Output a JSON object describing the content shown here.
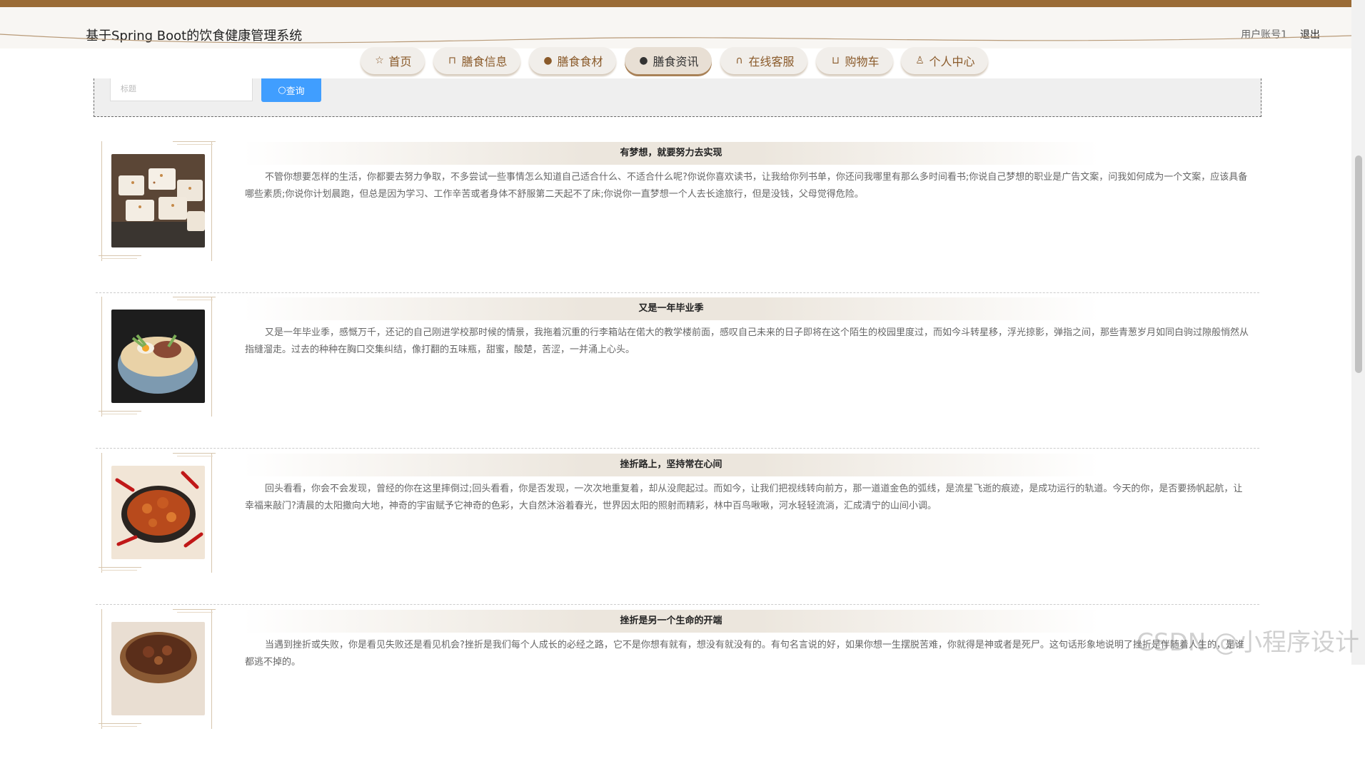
{
  "header": {
    "title": "基于Spring Boot的饮食健康管理系统",
    "user_label": "用户账号1",
    "logout_label": "退出"
  },
  "nav": [
    {
      "label": "首页",
      "icon": "star-icon",
      "glyph": "☆"
    },
    {
      "label": "膳食信息",
      "icon": "bag-icon",
      "glyph": "⊓"
    },
    {
      "label": "膳食食材",
      "icon": "info-circle-icon",
      "glyph": "●"
    },
    {
      "label": "膳食资讯",
      "icon": "help-circle-icon",
      "glyph": "●",
      "active": true
    },
    {
      "label": "在线客服",
      "icon": "headset-icon",
      "glyph": "∩"
    },
    {
      "label": "购物车",
      "icon": "cart-icon",
      "glyph": "⊔"
    },
    {
      "label": "个人中心",
      "icon": "user-icon",
      "glyph": "♙"
    }
  ],
  "search": {
    "placeholder": "标题",
    "button_label": "查询"
  },
  "articles": [
    {
      "title": "有梦想，就要努力去实现",
      "summary": "不管你想要怎样的生活，你都要去努力争取，不多尝试一些事情怎么知道自己适合什么、不适合什么呢?你说你喜欢读书，让我给你列书单，你还问我哪里有那么多时间看书;你说自己梦想的职业是广告文案，问我如何成为一个文案，应该具备哪些素质;你说你计划晨跑，但总是因为学习、工作辛苦或者身体不舒服第二天起不了床;你说你一直梦想一个人去长途旅行，但是没钱，父母觉得危险。"
    },
    {
      "title": "又是一年毕业季",
      "summary": "又是一年毕业季，感慨万千，还记的自己刚进学校那时候的情景，我拖着沉重的行李箱站在偌大的教学楼前面，感叹自己未来的日子即将在这个陌生的校园里度过，而如今斗转星移，浮光掠影，弹指之间，那些青葱岁月如同白驹过隙般悄然从指缝溜走。过去的种种在胸口交集纠结，像打翻的五味瓶，甜蜜，酸楚，苦涩，一并涌上心头。"
    },
    {
      "title": "挫折路上，坚持常在心间",
      "summary": "回头看看，你会不会发现，曾经的你在这里摔倒过;回头看看，你是否发现，一次次地重复着，却从没爬起过。而如今，让我们把视线转向前方，那一道道金色的弧线，是流星飞逝的痕迹，是成功运行的轨道。今天的你，是否要扬帆起航，让幸福来敲门?清晨的太阳撒向大地，神奇的宇宙赋予它神奇的色彩，大自然沐浴着春光，世界因太阳的照射而精彩，林中百鸟啾啾，河水轻轻流淌，汇成清宁的山间小调。"
    },
    {
      "title": "挫折是另一个生命的开端",
      "summary": "当遇到挫折或失败，你是看见失败还是看见机会?挫折是我们每个人成长的必经之路，它不是你想有就有，想没有就没有的。有句名言说的好，如果你想一生摆脱苦难，你就得是神或者是死尸。这句话形象地说明了挫折是伴随着人生的，是谁都逃不掉的。"
    }
  ],
  "watermark": "CSDN @小程序设计"
}
